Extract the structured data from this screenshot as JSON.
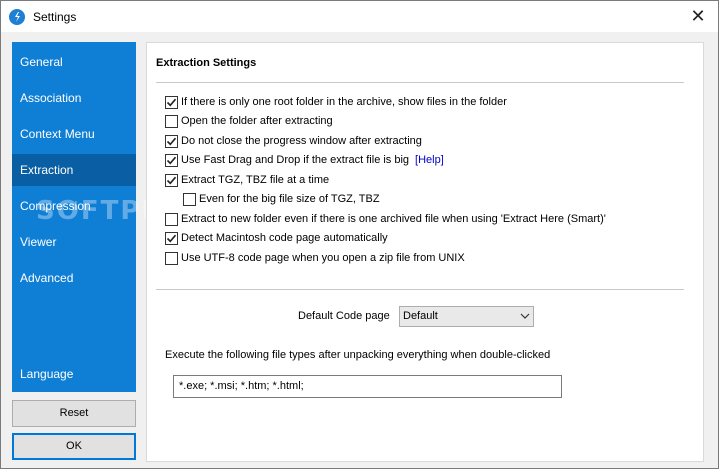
{
  "window": {
    "title": "Settings",
    "close_glyph": "✕"
  },
  "sidebar": {
    "items": [
      {
        "label": "General"
      },
      {
        "label": "Association"
      },
      {
        "label": "Context Menu"
      },
      {
        "label": "Extraction"
      },
      {
        "label": "Compression"
      },
      {
        "label": "Viewer"
      },
      {
        "label": "Advanced"
      }
    ],
    "language": "Language",
    "selected": "Extraction"
  },
  "buttons": {
    "reset": "Reset",
    "ok": "OK"
  },
  "extraction": {
    "title": "Extraction Settings",
    "options": [
      {
        "label": "If there is only one root folder in the archive, show files in the folder",
        "checked": true
      },
      {
        "label": "Open the folder after extracting",
        "checked": false
      },
      {
        "label": "Do not close the progress window after extracting",
        "checked": true
      },
      {
        "label": "Use Fast Drag and Drop if the extract file is big",
        "checked": true,
        "link": "[Help]"
      },
      {
        "label": "Extract TGZ, TBZ file at a time",
        "checked": true
      },
      {
        "label": "Even for the big file size of TGZ, TBZ",
        "checked": false
      },
      {
        "label": "Extract to new folder even if there is one archived file when using 'Extract Here (Smart)'",
        "checked": false
      },
      {
        "label": "Detect Macintosh code page automatically",
        "checked": true
      },
      {
        "label": "Use UTF-8 code page when you open a zip file from UNIX",
        "checked": false
      }
    ],
    "codepage_label": "Default Code page",
    "codepage_value": "Default",
    "exec_label": "Execute the following file types after unpacking everything when double-clicked",
    "exec_value": "*.exe; *.msi; *.htm; *.html;"
  },
  "watermark": "SOFTPEDIA",
  "colors": {
    "sidebar": "#0f7fd6",
    "sidebar_active": "#0a5ea3",
    "accent": "#0078d7"
  }
}
